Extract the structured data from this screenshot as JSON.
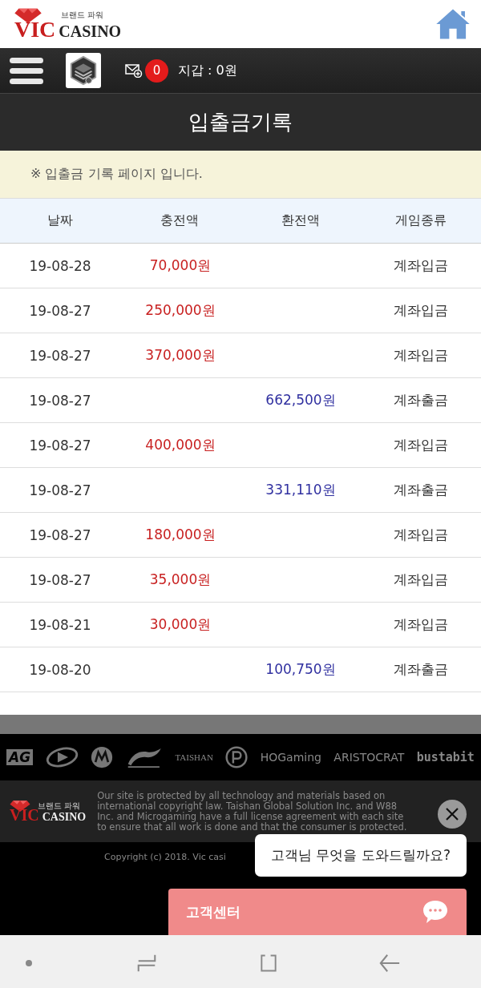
{
  "header": {
    "logo": {
      "tagline": "브랜드 파워",
      "brand": "VIC",
      "word": "CASINO"
    }
  },
  "nav_bar": {
    "message_count": "0",
    "wallet": "지갑 : 0원"
  },
  "page_title": "입출금기록",
  "notice": "※ 입출금 기록 페이지 입니다.",
  "table": {
    "columns": [
      "날짜",
      "충전액",
      "환전액",
      "게임종류"
    ],
    "rows": [
      {
        "date": "19-08-28",
        "deposit": "70,000원",
        "type": "계좌입금"
      },
      {
        "date": "19-08-27",
        "deposit": "250,000원",
        "type": "계좌입금"
      },
      {
        "date": "19-08-27",
        "deposit": "370,000원",
        "type": "계좌입금"
      },
      {
        "date": "19-08-27",
        "withdrawal": "662,500원",
        "type": "계좌출금"
      },
      {
        "date": "19-08-27",
        "deposit": "400,000원",
        "type": "계좌입금"
      },
      {
        "date": "19-08-27",
        "withdrawal": "331,110원",
        "type": "계좌출금"
      },
      {
        "date": "19-08-27",
        "deposit": "180,000원",
        "type": "계좌입금"
      },
      {
        "date": "19-08-27",
        "deposit": "35,000원",
        "type": "계좌입금"
      },
      {
        "date": "19-08-21",
        "deposit": "30,000원",
        "type": "계좌입금"
      },
      {
        "date": "19-08-20",
        "withdrawal": "100,750원",
        "type": "계좌출금"
      }
    ]
  },
  "footer": {
    "partners": [
      {
        "kind": "text",
        "label": "AG"
      },
      {
        "kind": "icon"
      },
      {
        "kind": "icon"
      },
      {
        "kind": "icon"
      },
      {
        "kind": "text",
        "label": "TAISHAN"
      },
      {
        "kind": "icon"
      },
      {
        "kind": "text",
        "label": "HOGaming"
      },
      {
        "kind": "text",
        "label": "ARISTOCRAT"
      },
      {
        "kind": "text",
        "label": "bustabit"
      }
    ],
    "logo": {
      "tagline": "브랜드 파워",
      "brand": "VIC",
      "word": "CASINO"
    },
    "legal": "Our site is protected by all technology and materials based on international copyright law. Taishan Global Solution Inc. and W88 Inc. and Microgaming have a full license agreement with each site to ensure that all work is done and that the consumer is protected.",
    "copyright": "Copyright (c) 2018. Vic casi"
  },
  "chat": {
    "bubble": "고객님 무엇을 도와드릴까요?",
    "button": "고객센터"
  }
}
